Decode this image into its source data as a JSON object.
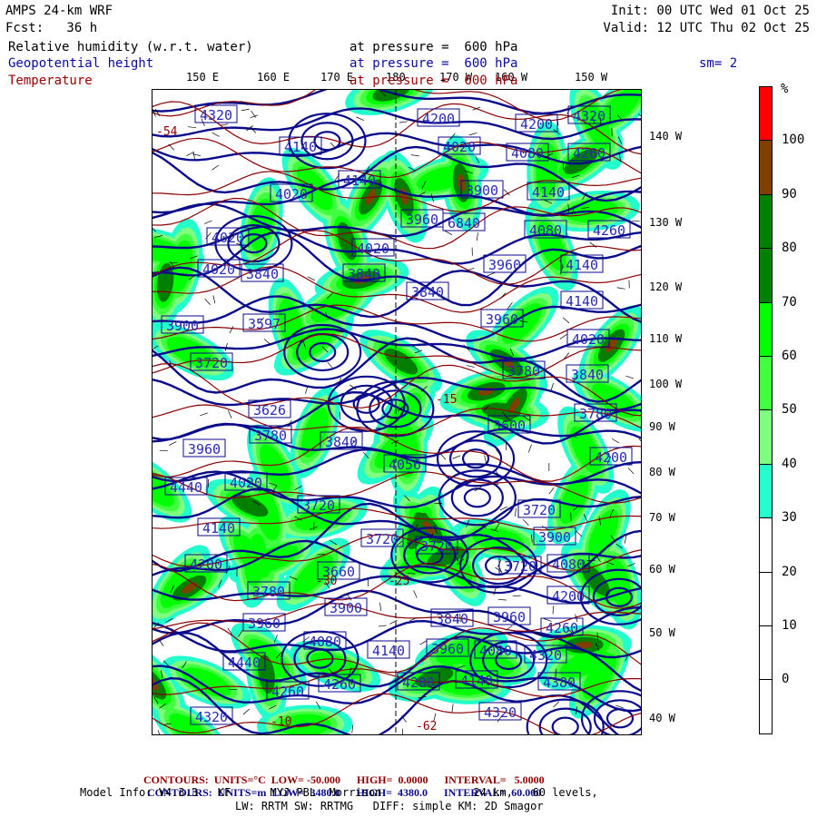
{
  "header": {
    "model": "AMPS 24-km WRF",
    "forecast": "Fcst:   36 h",
    "init": "Init: 00 UTC Wed 01 Oct 25",
    "valid": "Valid: 12 UTC Thu 02 Oct 25",
    "fields": [
      {
        "name": "Relative humidity (w.r.t. water)",
        "level": "at pressure =  600 hPa",
        "color": "#000000"
      },
      {
        "name": "Geopotential height",
        "level": "at pressure =  600 hPa",
        "color": "#0a0aa0"
      },
      {
        "name": "Temperature",
        "level": "at pressure =  600 hPa",
        "color": "#990000"
      }
    ],
    "smoothing": "sm= 2"
  },
  "map": {
    "top_labels": [
      "150 E",
      "160 E",
      "170 E",
      "180",
      "170 W",
      "160 W",
      "150 W"
    ],
    "right_labels": [
      "140 W",
      "130 W",
      "120 W",
      "110 W",
      "100 W",
      "90 W",
      "80 W",
      "70 W",
      "60 W",
      "50 W",
      "40 W"
    ],
    "height_contour_labels": [
      "4320",
      "4200",
      "4200",
      "4320",
      "4140",
      "4020",
      "4080",
      "4260",
      "4140",
      "4020",
      "3960",
      "3900",
      "6840",
      "4140",
      "4080",
      "4260",
      "4020",
      "4020",
      "4020",
      "3840",
      "3960",
      "4140",
      "3840",
      "3840",
      "4140",
      "3900",
      "3960",
      "3597",
      "3720",
      "4020",
      "3780",
      "3840",
      "3626",
      "3780",
      "3600",
      "3960",
      "3780",
      "3840",
      "4056",
      "4200",
      "4440",
      "4020",
      "3720",
      "3720",
      "3720",
      "3900",
      "3720",
      "4140",
      "4200",
      "3720",
      "4080",
      "3660",
      "3780",
      "4200",
      "3900",
      "3840",
      "3960",
      "3960",
      "4260",
      "4080",
      "4140",
      "3960",
      "4080",
      "4320",
      "4440",
      "4200",
      "4140",
      "4380",
      "4260",
      "4260",
      "4320",
      "4320"
    ],
    "temperature_labels": [
      "-54",
      "-30",
      "-25",
      "-15",
      "-10",
      "-62"
    ],
    "height_color": "#0a0a8c",
    "temperature_color": "#8c0000"
  },
  "colorbar": {
    "unit": "%",
    "labels": [
      "100",
      "90",
      "80",
      "70",
      "60",
      "50",
      "40",
      "30",
      "20",
      "10",
      "0"
    ],
    "colors": [
      "#ff0000",
      "#7f3f00",
      "#007f00",
      "#007f00",
      "#00ff00",
      "#3fff3f",
      "#7fff7f",
      "#22ffcc",
      "#ffffff",
      "#ffffff",
      "#ffffff",
      "#ffffff"
    ]
  },
  "footer": {
    "temp_contours": {
      "label": "CONTOURS:",
      "units": "UNITS=°C",
      "low": "LOW= -50.000",
      "high": "HIGH=  0.0000",
      "interval": "INTERVAL=   5.0000"
    },
    "height_contours": {
      "label": "CONTOURS:",
      "units": "UNITS=m",
      "low": "LOW=  3480.0",
      "high": "HIGH=  4380.0",
      "interval": "INTERVAL=  60.000"
    },
    "model_info": "Model Info: V4.3.3   KF      MYJ PBL  Morrison              24 km,   60 levels,",
    "physics": "LW: RRTM SW: RRTMG   DIFF: simple KM: 2D Smagor"
  }
}
